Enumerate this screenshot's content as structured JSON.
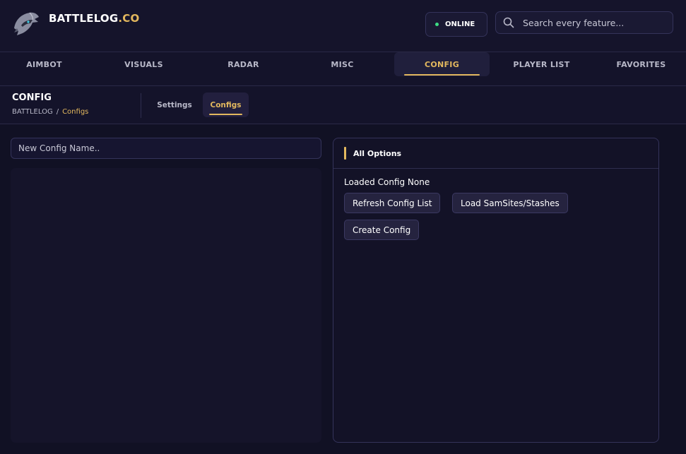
{
  "brand": {
    "name": "BATTLELOG",
    "suffix": ".CO"
  },
  "status": {
    "label": "ONLINE",
    "color": "#3ddc84"
  },
  "search": {
    "placeholder": "Search every feature..."
  },
  "nav": {
    "tabs": [
      {
        "label": "AIMBOT"
      },
      {
        "label": "VISUALS"
      },
      {
        "label": "RADAR"
      },
      {
        "label": "MISC"
      },
      {
        "label": "CONFIG"
      },
      {
        "label": "PLAYER LIST"
      },
      {
        "label": "FAVORITES"
      }
    ],
    "active": "CONFIG"
  },
  "page": {
    "title": "CONFIG",
    "breadcrumb": {
      "root": "BATTLELOG",
      "separator": "/",
      "current": "Configs"
    },
    "subtabs": [
      {
        "label": "Settings"
      },
      {
        "label": "Configs"
      }
    ],
    "active_subtab": "Configs"
  },
  "config_input": {
    "placeholder": "New Config Name.."
  },
  "options_panel": {
    "title": "All Options",
    "loaded_label": "Loaded Config None",
    "buttons": {
      "refresh": "Refresh Config List",
      "load_sam": "Load SamSites/Stashes",
      "create": "Create Config"
    }
  },
  "colors": {
    "accent": "#e3b85e",
    "background": "#111124"
  },
  "icons": {
    "logo": "knight-helmet-logo",
    "search": "search-icon",
    "status": "status-dot"
  }
}
